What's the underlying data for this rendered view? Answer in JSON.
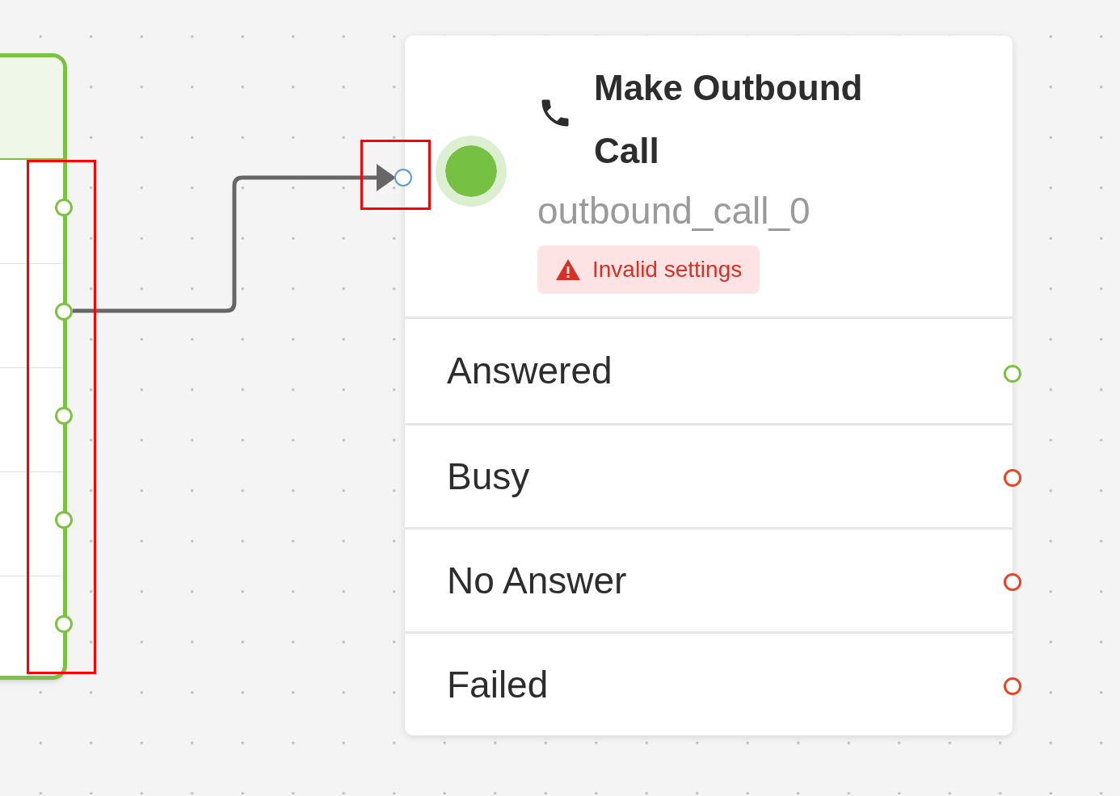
{
  "left_node": {
    "outputs": [
      {
        "color": "#7cc142"
      },
      {
        "color": "#7cc142"
      },
      {
        "color": "#7cc142"
      },
      {
        "color": "#7cc142"
      },
      {
        "color": "#7cc142"
      }
    ]
  },
  "node": {
    "title": "Make Outbound Call",
    "id": "outbound_call_0",
    "warning": "Invalid settings",
    "outputs": [
      {
        "label": "Answered",
        "color": "#7cc142"
      },
      {
        "label": "Busy",
        "color": "#e8442a"
      },
      {
        "label": "No Answer",
        "color": "#e8442a"
      },
      {
        "label": "Failed",
        "color": "#e8442a"
      }
    ]
  }
}
